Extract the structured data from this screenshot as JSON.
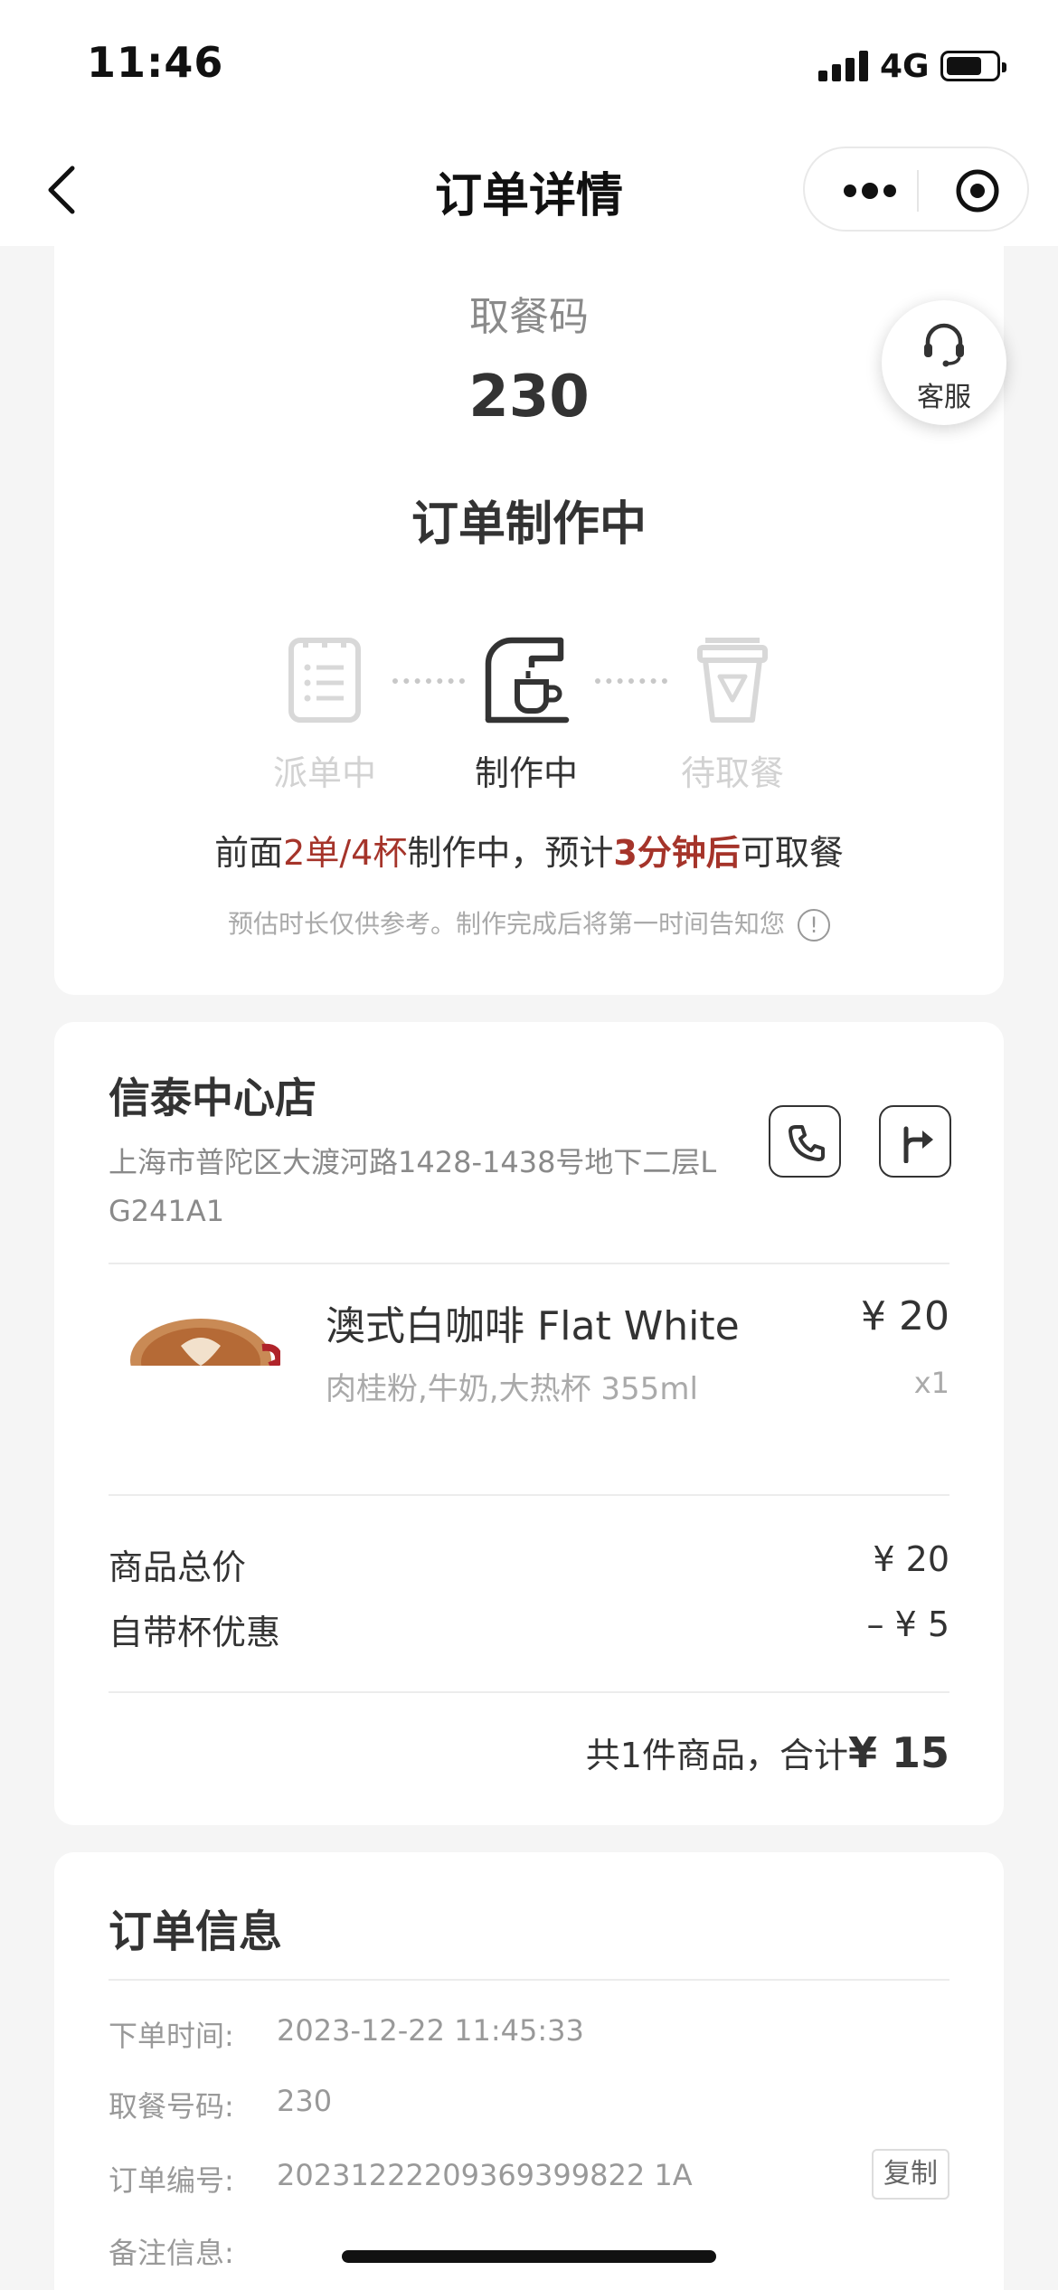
{
  "status_bar": {
    "time": "11:46",
    "network": "4G"
  },
  "nav": {
    "title": "订单详情"
  },
  "order": {
    "pickup_label": "取餐码",
    "pickup_code": "230",
    "status": "订单制作中",
    "customer_service": "客服",
    "steps": [
      {
        "label": "派单中",
        "state": "done"
      },
      {
        "label": "制作中",
        "state": "active"
      },
      {
        "label": "待取餐",
        "state": "pending"
      }
    ],
    "queue": {
      "prefix": "前面",
      "orders": "2单/4杯",
      "middle": "制作中，预计",
      "eta": "3分钟后",
      "suffix": "可取餐"
    },
    "tip": "预估时长仅供参考。制作完成后将第一时间告知您",
    "tip_icon": "!"
  },
  "store": {
    "name": "信泰中心店",
    "address": "上海市普陀区大渡河路1428-1438号地下二层L G241A1"
  },
  "product": {
    "name": "澳式白咖啡 Flat White",
    "options": "肉桂粉,牛奶,大热杯 355ml",
    "price": "¥ 20",
    "qty": "x1"
  },
  "summary": {
    "subtotal_label": "商品总价",
    "subtotal_value": "¥ 20",
    "discount_label": "自带杯优惠",
    "discount_value": "– ¥ 5",
    "total_prefix": "共1件商品，合计",
    "total_amount": "¥ 15"
  },
  "order_info": {
    "title": "订单信息",
    "rows": [
      {
        "label": "下单时间:",
        "value": "2023-12-22 11:45:33"
      },
      {
        "label": "取餐号码:",
        "value": "230"
      },
      {
        "label": "订单编号:",
        "value": "20231222209369399822 1A"
      },
      {
        "label": "备注信息:",
        "value": ""
      }
    ],
    "copy_label": "复制"
  },
  "colors": {
    "accent": "#a5342a",
    "muted": "#aaaaaa",
    "background": "#f5f5f5"
  }
}
